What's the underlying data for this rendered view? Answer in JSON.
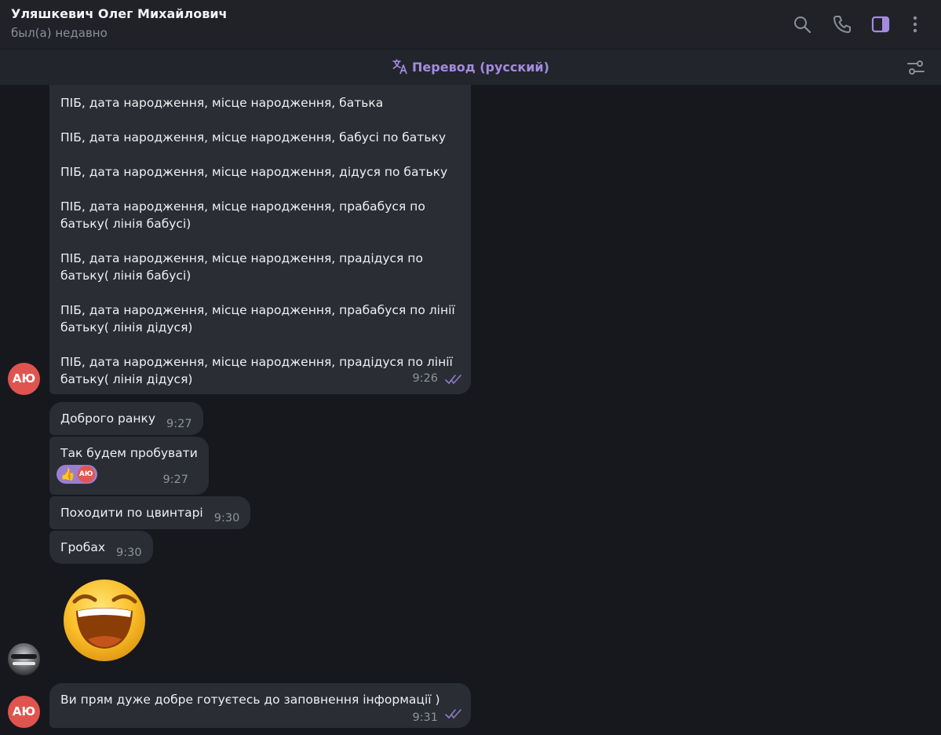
{
  "header": {
    "contact_name": "Уляшкевич Олег Михайлович",
    "status": "был(а) недавно",
    "icons": [
      "search-icon",
      "phone-icon",
      "sidebar-toggle-icon",
      "more-vertical-icon"
    ]
  },
  "translation_bar": {
    "label": "Перевод (русский)",
    "icons": [
      "translate-icon",
      "settings-sliders-icon"
    ],
    "accent_color": "#a48bdf"
  },
  "messages": {
    "long": {
      "lines": [
        "ПІБ, дата народження, місце народження, батька",
        "ПІБ, дата народження, місце народження, бабусі по батьку",
        "ПІБ, дата народження, місце народження, дідуся по батьку",
        "ПІБ, дата народження, місце народження, прабабуся по батьку( лінія бабусі)",
        "ПІБ, дата народження, місце народження, прадідуся по батьку( лінія бабусі)",
        "ПІБ, дата народження, місце народження, прабабуся по лінії батьку( лінія дідуся)",
        "ПІБ, дата народження, місце народження, прадідуся по лінії батьку( лінія дідуся)"
      ],
      "time": "9:26",
      "read": true
    },
    "m1": {
      "text": "Доброго ранку",
      "time": "9:27"
    },
    "m2": {
      "text": "Так будем пробувати",
      "time": "9:27",
      "reaction": {
        "emoji": "👍",
        "avatar_initials": "АЮ"
      }
    },
    "m3": {
      "text": "Походити по цвинтарі",
      "time": "9:30"
    },
    "m4": {
      "text": "Гробах",
      "time": "9:30"
    },
    "sticker": {
      "name": "laughing-emoji-sticker"
    },
    "m5": {
      "text": "Ви прям дуже добре готуєтесь до заповнення інформації )",
      "time": "9:31",
      "read": true
    }
  },
  "avatars": {
    "self_initials": "АЮ",
    "self_color": "#e0544f"
  },
  "colors": {
    "background": "#17181d",
    "bubble": "#2a2d33",
    "header": "#202228",
    "read_ticks": "#a48bdf"
  }
}
